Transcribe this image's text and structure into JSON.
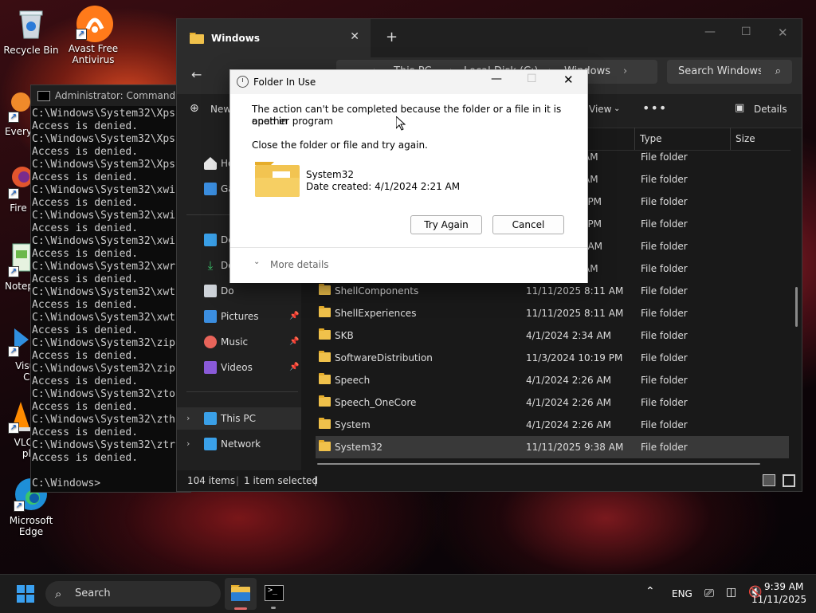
{
  "desktop": {
    "icons": [
      {
        "label": "Recycle Bin"
      },
      {
        "label": "Avast Free Antivirus"
      },
      {
        "label": "Every"
      },
      {
        "label": "Fire"
      },
      {
        "label": "Notep"
      },
      {
        "label": "Visual Co"
      },
      {
        "label": "VLC m pla"
      },
      {
        "label": "Microsoft Edge"
      }
    ]
  },
  "cmd": {
    "title": "Administrator: Command Prompt",
    "lines": [
      "C:\\Windows\\System32\\Xps",
      "Access is denied.",
      "C:\\Windows\\System32\\Xps",
      "Access is denied.",
      "C:\\Windows\\System32\\Xps",
      "Access is denied.",
      "C:\\Windows\\System32\\xwi",
      "Access is denied.",
      "C:\\Windows\\System32\\xwi",
      "Access is denied.",
      "C:\\Windows\\System32\\xwi",
      "Access is denied.",
      "C:\\Windows\\System32\\xwr",
      "Access is denied.",
      "C:\\Windows\\System32\\xwt",
      "Access is denied.",
      "C:\\Windows\\System32\\xwt",
      "Access is denied.",
      "C:\\Windows\\System32\\zip",
      "Access is denied.",
      "C:\\Windows\\System32\\zip",
      "Access is denied.",
      "C:\\Windows\\System32\\zto",
      "Access is denied.",
      "C:\\Windows\\System32\\zth",
      "Access is denied.",
      "C:\\Windows\\System32\\ztr",
      "Access is denied.",
      "",
      "C:\\Windows>"
    ]
  },
  "explorer": {
    "tab_title": "Windows",
    "breadcrumb": [
      "This PC",
      "Local Disk (C:)",
      "Windows"
    ],
    "search_placeholder": "Search Windows",
    "toolbar": {
      "new_label": "New",
      "view_label": "View",
      "details_label": "Details"
    },
    "columns": {
      "type": "Type",
      "size": "Size"
    },
    "nav_items": [
      {
        "label": "Ho"
      },
      {
        "label": "Ga"
      },
      {
        "label": "De"
      },
      {
        "label": "Do"
      },
      {
        "label": "Do"
      },
      {
        "label": "Pictures"
      },
      {
        "label": "Music"
      },
      {
        "label": "Videos"
      },
      {
        "label": "This PC"
      },
      {
        "label": "Network"
      }
    ],
    "partial_rows": [
      {
        "date": "AM",
        "type": "File folder"
      },
      {
        "date": "AM",
        "type": "File folder"
      },
      {
        "date": "4 PM",
        "type": "File folder"
      },
      {
        "date": "7 PM",
        "type": "File folder"
      },
      {
        "date": "1 AM",
        "type": "File folder"
      },
      {
        "date": "AM",
        "type": "File folder"
      }
    ],
    "rows": [
      {
        "name": "ShellComponents",
        "date": "11/11/2025 8:11 AM",
        "type": "File folder"
      },
      {
        "name": "ShellExperiences",
        "date": "11/11/2025 8:11 AM",
        "type": "File folder"
      },
      {
        "name": "SKB",
        "date": "4/1/2024 2:34 AM",
        "type": "File folder"
      },
      {
        "name": "SoftwareDistribution",
        "date": "11/3/2024 10:19 PM",
        "type": "File folder"
      },
      {
        "name": "Speech",
        "date": "4/1/2024 2:26 AM",
        "type": "File folder"
      },
      {
        "name": "Speech_OneCore",
        "date": "4/1/2024 2:26 AM",
        "type": "File folder"
      },
      {
        "name": "System",
        "date": "4/1/2024 2:26 AM",
        "type": "File folder"
      },
      {
        "name": "System32",
        "date": "11/11/2025 9:38 AM",
        "type": "File folder"
      }
    ],
    "status": {
      "items": "104 items",
      "selected": "1 item selected"
    }
  },
  "dialog": {
    "title": "Folder In Use",
    "message_line1": "The action can't be completed because the folder or a file in it is open in",
    "message_line2": "another program",
    "instruction": "Close the folder or file and try again.",
    "item_name": "System32",
    "item_date": "Date created: 4/1/2024 2:21 AM",
    "try_again": "Try Again",
    "cancel": "Cancel",
    "more_details": "More details"
  },
  "taskbar": {
    "search_label": "Search",
    "language": "ENG",
    "time": "9:39 AM",
    "date": "11/11/2025"
  },
  "colors": {
    "accent": "#0b5fd0",
    "folder": "#f0c14b",
    "dark_bg": "#191919"
  }
}
